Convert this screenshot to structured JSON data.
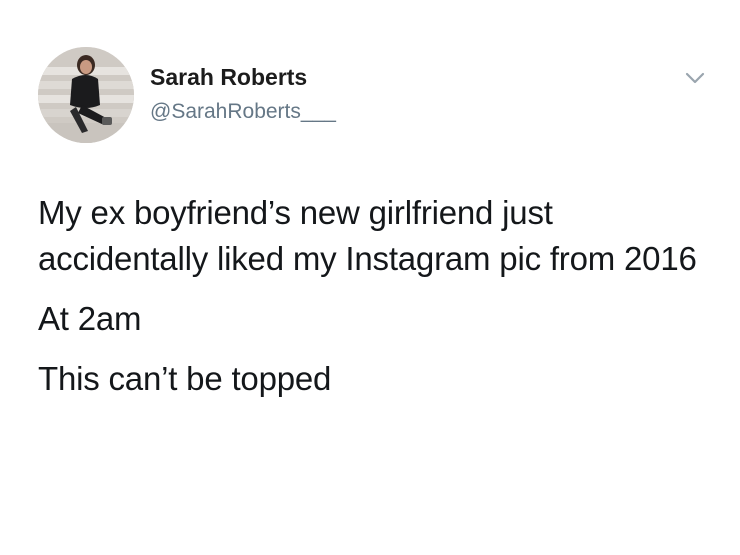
{
  "tweet": {
    "author": {
      "display_name": "Sarah Roberts",
      "handle": "@SarahRoberts___"
    },
    "avatar_icon": "profile-photo",
    "menu_icon": "chevron-down-icon",
    "paragraphs": [
      "My ex boyfriend’s new girlfriend just accidentally liked my Instagram pic from 2016",
      "At 2am",
      "This can’t be topped"
    ]
  }
}
